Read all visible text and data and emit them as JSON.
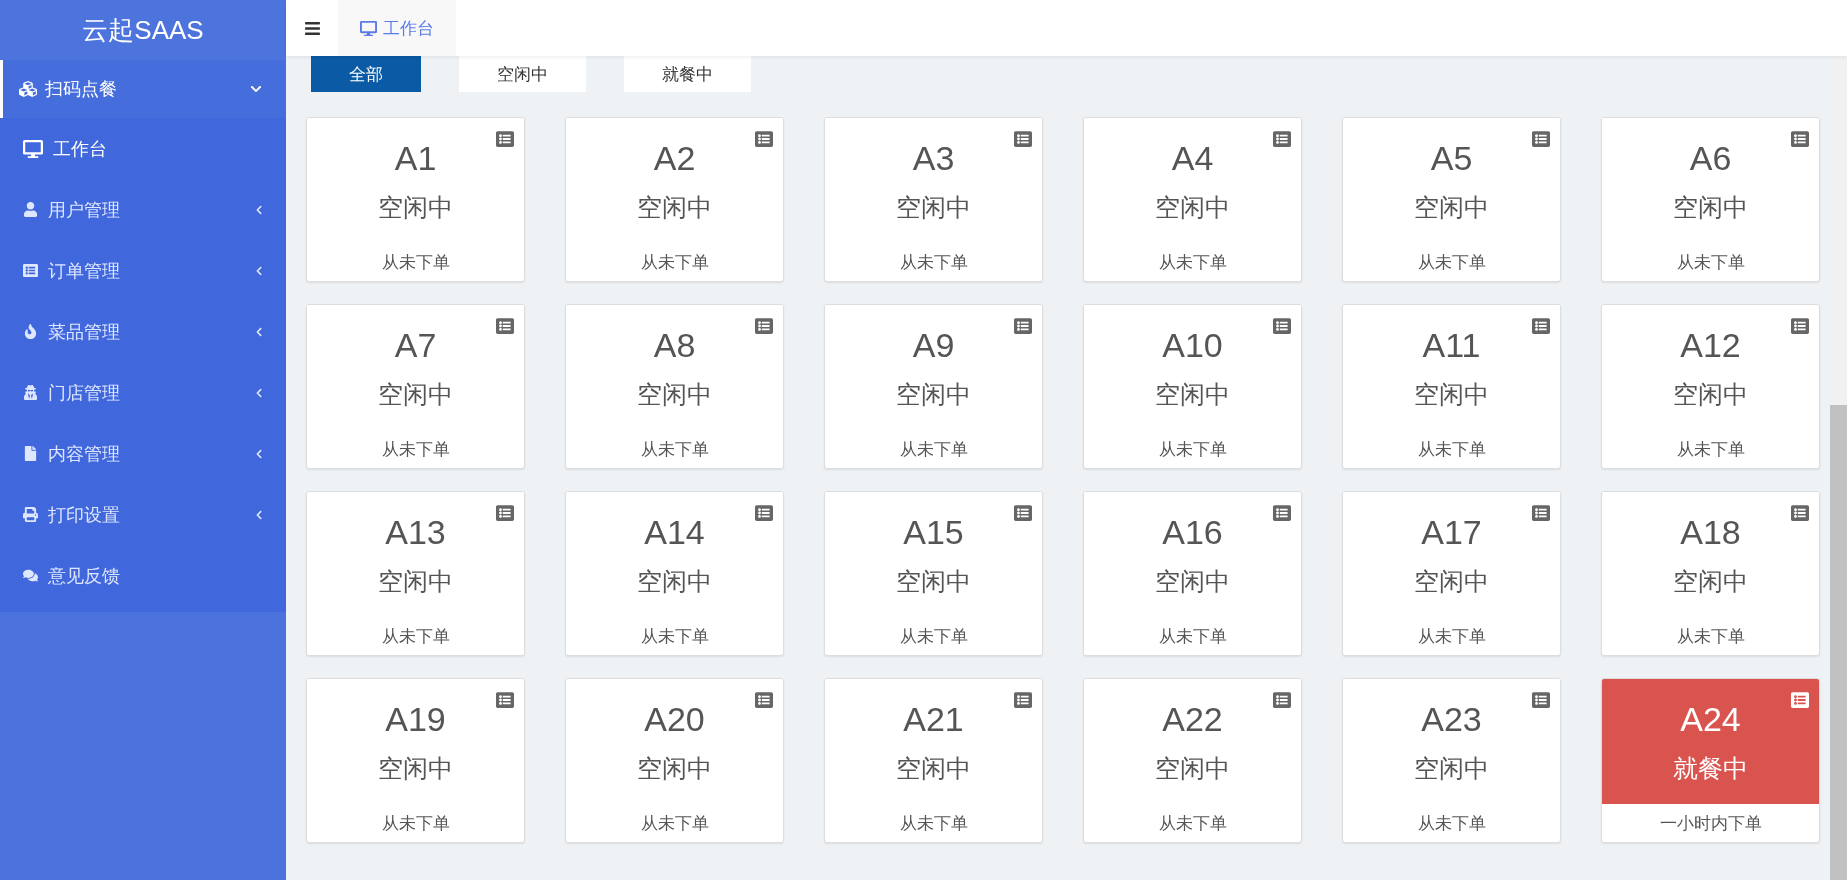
{
  "sidebar": {
    "logo": "云起SAAS",
    "group": {
      "label": "扫码点餐",
      "expanded": true
    },
    "items": [
      {
        "label": "工作台",
        "selected": true,
        "has_submenu": false
      },
      {
        "label": "用户管理",
        "selected": false,
        "has_submenu": true
      },
      {
        "label": "订单管理",
        "selected": false,
        "has_submenu": true
      },
      {
        "label": "菜品管理",
        "selected": false,
        "has_submenu": true
      },
      {
        "label": "门店管理",
        "selected": false,
        "has_submenu": true
      },
      {
        "label": "内容管理",
        "selected": false,
        "has_submenu": true
      },
      {
        "label": "打印设置",
        "selected": false,
        "has_submenu": true
      },
      {
        "label": "意见反馈",
        "selected": false,
        "has_submenu": false
      }
    ]
  },
  "header": {
    "tabs": [
      {
        "label": "工作台",
        "selected": true
      }
    ]
  },
  "filters": [
    {
      "label": "全部",
      "selected": true
    },
    {
      "label": "空闲中",
      "selected": false
    },
    {
      "label": "就餐中",
      "selected": false
    }
  ],
  "tables": [
    {
      "name": "A1",
      "status": "空闲中",
      "note": "从未下单",
      "kind": "idle"
    },
    {
      "name": "A2",
      "status": "空闲中",
      "note": "从未下单",
      "kind": "idle"
    },
    {
      "name": "A3",
      "status": "空闲中",
      "note": "从未下单",
      "kind": "idle"
    },
    {
      "name": "A4",
      "status": "空闲中",
      "note": "从未下单",
      "kind": "idle"
    },
    {
      "name": "A5",
      "status": "空闲中",
      "note": "从未下单",
      "kind": "idle"
    },
    {
      "name": "A6",
      "status": "空闲中",
      "note": "从未下单",
      "kind": "idle"
    },
    {
      "name": "A7",
      "status": "空闲中",
      "note": "从未下单",
      "kind": "idle"
    },
    {
      "name": "A8",
      "status": "空闲中",
      "note": "从未下单",
      "kind": "idle"
    },
    {
      "name": "A9",
      "status": "空闲中",
      "note": "从未下单",
      "kind": "idle"
    },
    {
      "name": "A10",
      "status": "空闲中",
      "note": "从未下单",
      "kind": "idle"
    },
    {
      "name": "A11",
      "status": "空闲中",
      "note": "从未下单",
      "kind": "idle"
    },
    {
      "name": "A12",
      "status": "空闲中",
      "note": "从未下单",
      "kind": "idle"
    },
    {
      "name": "A13",
      "status": "空闲中",
      "note": "从未下单",
      "kind": "idle"
    },
    {
      "name": "A14",
      "status": "空闲中",
      "note": "从未下单",
      "kind": "idle"
    },
    {
      "name": "A15",
      "status": "空闲中",
      "note": "从未下单",
      "kind": "idle"
    },
    {
      "name": "A16",
      "status": "空闲中",
      "note": "从未下单",
      "kind": "idle"
    },
    {
      "name": "A17",
      "status": "空闲中",
      "note": "从未下单",
      "kind": "idle"
    },
    {
      "name": "A18",
      "status": "空闲中",
      "note": "从未下单",
      "kind": "idle"
    },
    {
      "name": "A19",
      "status": "空闲中",
      "note": "从未下单",
      "kind": "idle"
    },
    {
      "name": "A20",
      "status": "空闲中",
      "note": "从未下单",
      "kind": "idle"
    },
    {
      "name": "A21",
      "status": "空闲中",
      "note": "从未下单",
      "kind": "idle"
    },
    {
      "name": "A22",
      "status": "空闲中",
      "note": "从未下单",
      "kind": "idle"
    },
    {
      "name": "A23",
      "status": "空闲中",
      "note": "从未下单",
      "kind": "idle"
    },
    {
      "name": "A24",
      "status": "就餐中",
      "note": "一小时内下单",
      "kind": "dining"
    }
  ]
}
